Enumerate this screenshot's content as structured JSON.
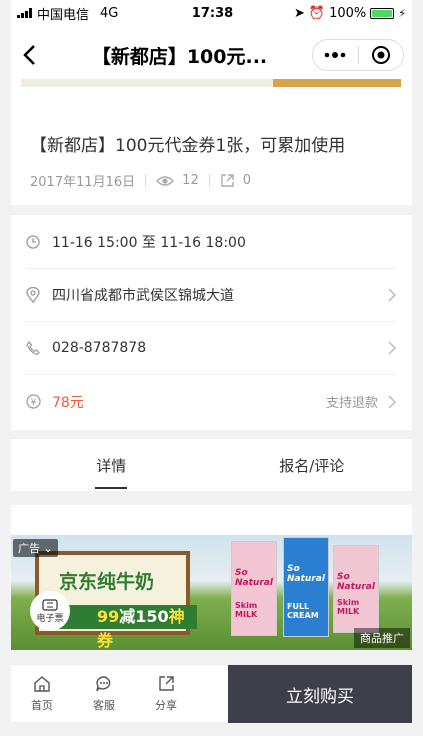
{
  "status_bar": {
    "carrier": "中国电信",
    "network": "4G",
    "time": "17:38",
    "battery": "100%"
  },
  "nav": {
    "title": "【新都店】100元..."
  },
  "event": {
    "title": "【新都店】100元代金券1张，可累加使用",
    "date": "2017年11月16日",
    "views": "12",
    "shares": "0"
  },
  "info": {
    "time_range": "11-16 15:00 至 11-16 18:00",
    "address": "四川省成都市武侯区锦城大道",
    "phone": "028-8787878",
    "price": "78元",
    "refund": "支持退款"
  },
  "tabs": [
    {
      "label": "详情"
    },
    {
      "label": "报名/评论"
    }
  ],
  "ad": {
    "tag": "广告",
    "headline": "京东纯牛奶",
    "deal_prefix": "99",
    "deal_highlight": "减150",
    "deal_suffix": "神券",
    "e_ticket": "电子票",
    "promo": "商品推广",
    "brand": "So Natural",
    "products": [
      "Skim MILK",
      "FULL CREAM",
      "Skim MILK"
    ]
  },
  "bottom": {
    "items": [
      {
        "label": "首页"
      },
      {
        "label": "客服"
      },
      {
        "label": "分享"
      }
    ],
    "buy": "立刻购买"
  },
  "colors": {
    "price": "#f15a3c",
    "buy_bg": "#3f3f4a",
    "battery": "#4cd964"
  }
}
